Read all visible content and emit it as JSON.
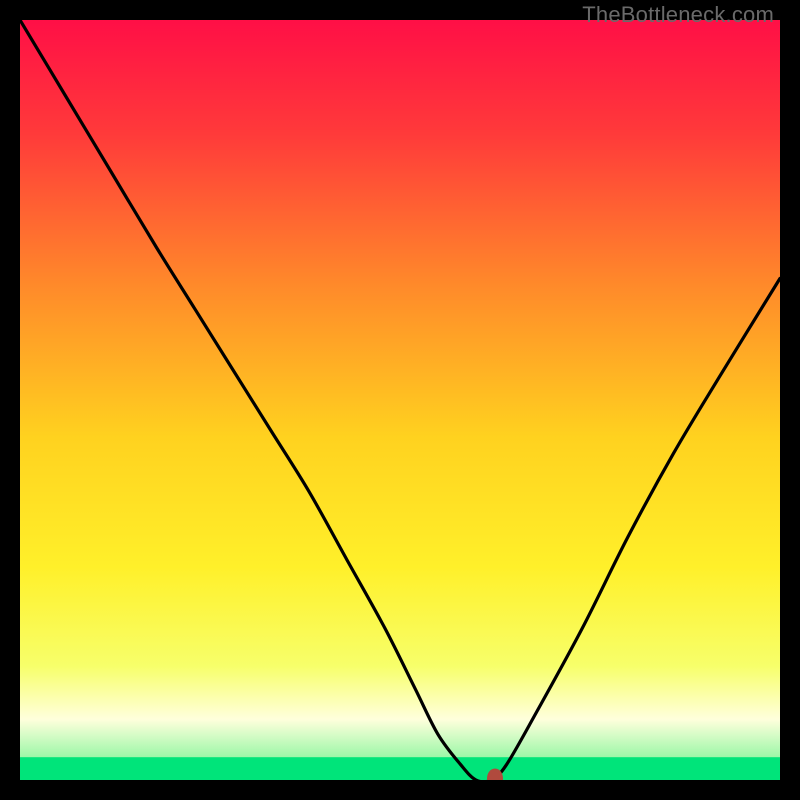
{
  "watermark": "TheBottleneck.com",
  "chart_data": {
    "type": "line",
    "title": "",
    "xlabel": "",
    "ylabel": "",
    "xlim": [
      0,
      100
    ],
    "ylim": [
      0,
      100
    ],
    "grid": false,
    "series": [
      {
        "name": "bottleneck-curve",
        "x": [
          0,
          6,
          12,
          18,
          23,
          28,
          33,
          38,
          43,
          48,
          52,
          55,
          58,
          60,
          62,
          64,
          68,
          74,
          80,
          86,
          92,
          100
        ],
        "y": [
          100,
          90,
          80,
          70,
          62,
          54,
          46,
          38,
          29,
          20,
          12,
          6,
          2,
          0,
          0,
          2,
          9,
          20,
          32,
          43,
          53,
          66
        ]
      }
    ],
    "marker": {
      "x": 62.5,
      "y": 0.2
    },
    "optimal_band": {
      "from": 0,
      "to": 3
    },
    "gradient_stops": [
      {
        "pct": 0,
        "color": "#ff0f46"
      },
      {
        "pct": 15,
        "color": "#ff3a3a"
      },
      {
        "pct": 35,
        "color": "#ff8a2a"
      },
      {
        "pct": 55,
        "color": "#ffd21f"
      },
      {
        "pct": 72,
        "color": "#fff02a"
      },
      {
        "pct": 85,
        "color": "#f7ff6a"
      },
      {
        "pct": 92,
        "color": "#ffffdc"
      },
      {
        "pct": 97,
        "color": "#9cf7a8"
      },
      {
        "pct": 100,
        "color": "#00e47a"
      }
    ]
  }
}
